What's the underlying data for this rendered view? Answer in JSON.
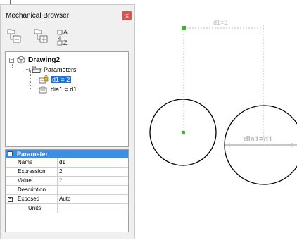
{
  "panel": {
    "title": "Mechanical Browser",
    "close_label": "x",
    "toolbar": {
      "sort_a": "A",
      "sort_z": "Z"
    }
  },
  "tree": {
    "root": "Drawing2",
    "group": "Parameters",
    "items": [
      {
        "label": "d1 = 2",
        "selected": true
      },
      {
        "label": "dia1 = d1",
        "selected": false
      }
    ]
  },
  "properties": {
    "category": "Parameter",
    "rows": [
      {
        "name": "Name",
        "value": "d1"
      },
      {
        "name": "Expression",
        "value": "2"
      },
      {
        "name": "Value",
        "value": "2"
      },
      {
        "name": "Description",
        "value": ""
      },
      {
        "name": "Exposed",
        "value": "Auto"
      },
      {
        "name": "Units",
        "value": ""
      }
    ]
  },
  "drawing": {
    "dim1_label": "d1=2",
    "dim2_label": "dia1=d1",
    "grip_color": "#3cb52d",
    "selection_color": "#1f6fd6"
  }
}
